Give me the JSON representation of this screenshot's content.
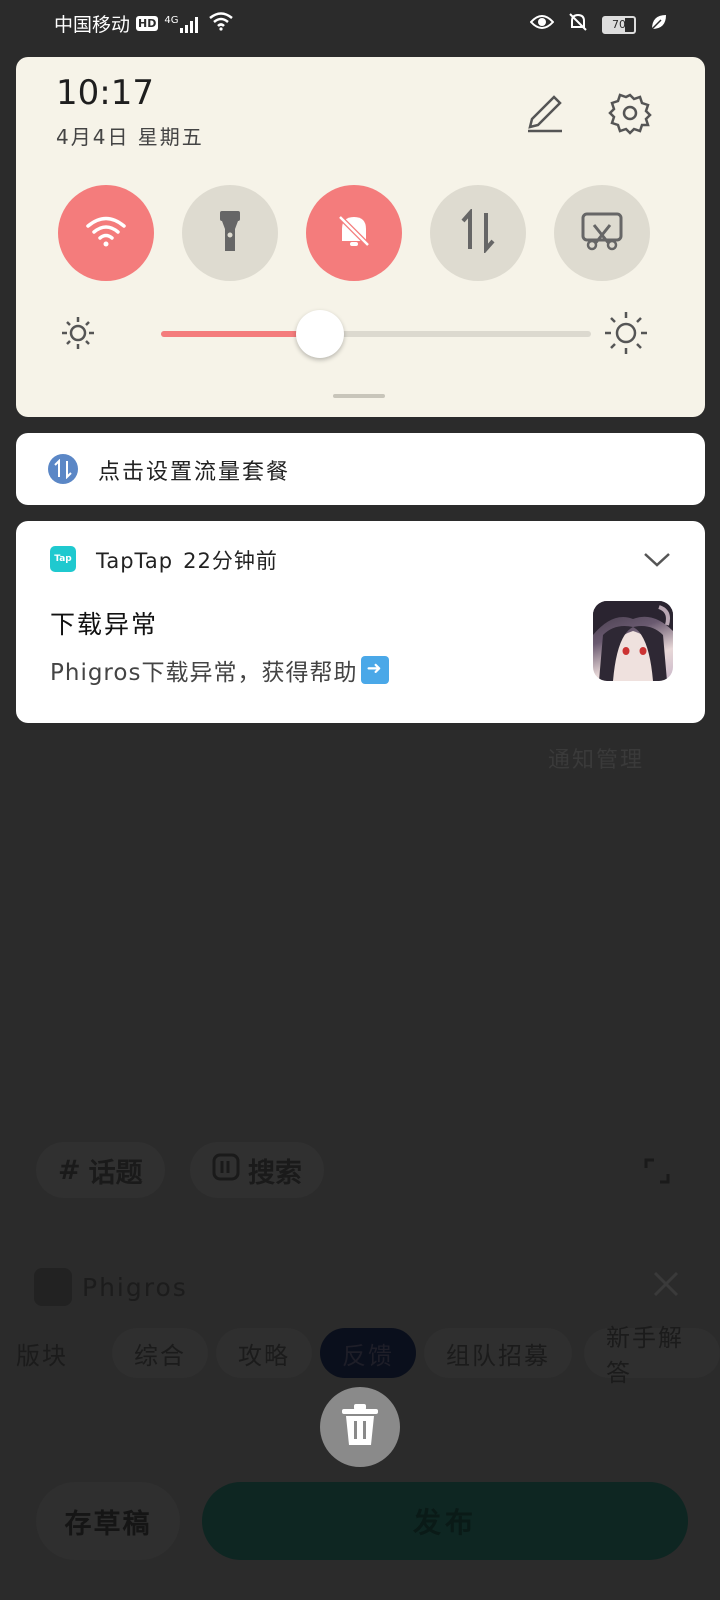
{
  "status_bar": {
    "carrier": "中国移动",
    "hd": "HD",
    "network": "4G",
    "battery": "70",
    "icons": [
      "eye-icon",
      "bell-off-icon",
      "battery-icon",
      "leaf-icon"
    ]
  },
  "quick_settings": {
    "time": "10:17",
    "date": "4月4日 星期五",
    "toggles": [
      {
        "name": "wifi",
        "on": true
      },
      {
        "name": "flashlight",
        "on": false
      },
      {
        "name": "mute",
        "on": true
      },
      {
        "name": "mobile-data",
        "on": false
      },
      {
        "name": "screenshot",
        "on": false
      }
    ],
    "brightness_fraction": 0.37
  },
  "data_plan_notification": {
    "text": "点击设置流量套餐"
  },
  "taptap_notification": {
    "app": "TapTap",
    "logo": "Tap",
    "time": "22分钟前",
    "title": "下载异常",
    "body": "Phigros下载异常，获得帮助"
  },
  "notification_manage": "通知管理",
  "background_app": {
    "chips": [
      {
        "icon": "#",
        "label": "话题"
      },
      {
        "icon": "search",
        "label": "搜索"
      }
    ],
    "game_name": "Phigros",
    "tabs": [
      "版块",
      "综合",
      "攻略",
      "反馈",
      "组队招募",
      "新手解答"
    ],
    "active_tab": "反馈",
    "save_draft": "存草稿",
    "publish": "发布"
  },
  "colors": {
    "accent": "#f47c7c",
    "panel": "#f6f3e8",
    "tap_brand": "#1fc9cf"
  }
}
